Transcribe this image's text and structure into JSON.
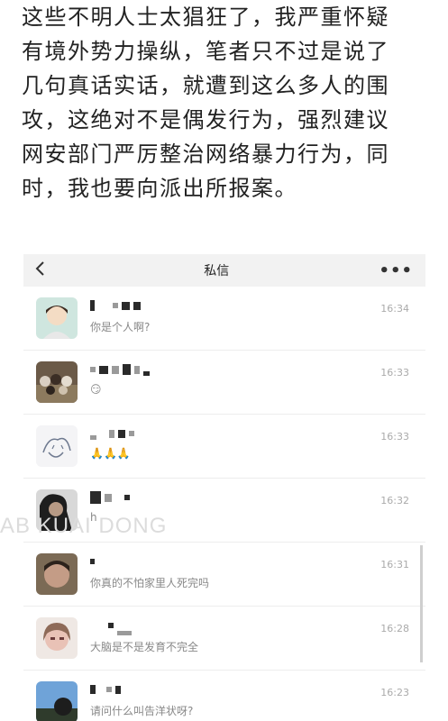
{
  "article": {
    "lines": [
      "这些不明人士太猖狂了，我严重怀疑",
      "有境外势力操纵，笔者只不过是说了",
      "几句真话实话，就遭到这么多人的围",
      "攻，这绝对不是偶发行为，强烈建议",
      "网安部门严厉整治网络暴力行为，同",
      "时，我也要向派出所报案。"
    ]
  },
  "nav": {
    "back_icon": "chevron-left-icon",
    "title": "私信",
    "more_icon": "ellipsis-icon",
    "more_label": "•••"
  },
  "messages": [
    {
      "preview": "你是个人啊?",
      "time": "16:34"
    },
    {
      "preview": "😏",
      "time": "16:33"
    },
    {
      "preview": "🙏🙏🙏",
      "time": "16:33"
    },
    {
      "preview": "h",
      "time": "16:32"
    },
    {
      "preview": "你真的不怕家里人死完吗",
      "time": "16:31"
    },
    {
      "preview": "大脑是不是发育不完全",
      "time": "16:28"
    },
    {
      "preview": "请问什么叫告洋状呀?",
      "time": "16:23"
    }
  ],
  "watermark": "AB KUAI DONG"
}
